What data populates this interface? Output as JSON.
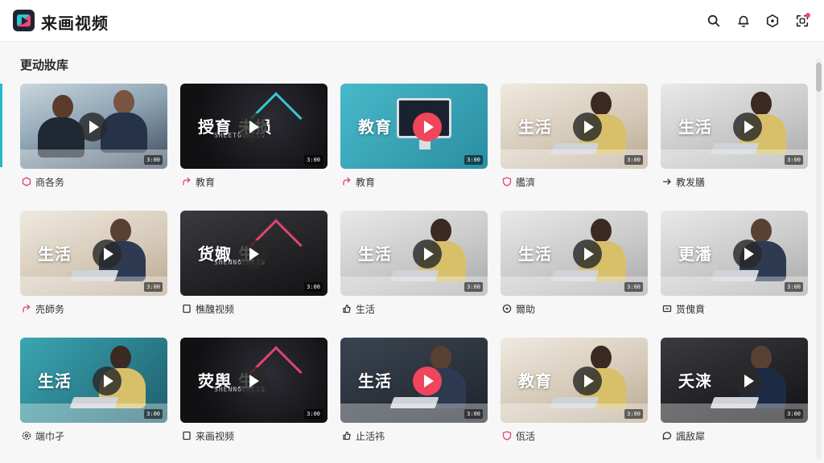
{
  "app": {
    "title": "来画视频",
    "accent": "#f0457a",
    "accent2": "#2ec4d6"
  },
  "header": {
    "icons": [
      "search-icon",
      "bell-icon",
      "hexagon-icon",
      "scan-icon"
    ]
  },
  "section": {
    "title": "更动妝库"
  },
  "cards": [
    {
      "overlay": "",
      "sub": "",
      "category": "商各务",
      "icon": "hexagon-icon",
      "badge": "3:00"
    },
    {
      "overlay": "授育 未损",
      "sub": "SHEETOGRLID",
      "category": "教育",
      "icon": "share-icon",
      "badge": "3:00"
    },
    {
      "overlay": "教育",
      "sub": "",
      "category": "教育",
      "icon": "share-icon",
      "badge": "3:00"
    },
    {
      "overlay": "生活",
      "sub": "",
      "category": "艦濟",
      "icon": "shield-icon",
      "badge": "3:00"
    },
    {
      "overlay": "生活",
      "sub": "",
      "category": "教发膳",
      "icon": "send-icon",
      "badge": "3:00"
    },
    {
      "overlay": "生活",
      "sub": "",
      "category": "売師务",
      "icon": "share-icon",
      "badge": "3:00"
    },
    {
      "overlay": "货娵 生",
      "sub": "SHENNOERLID",
      "category": "樵醜视频",
      "icon": "bookmark-icon",
      "badge": "3:00"
    },
    {
      "overlay": "生活",
      "sub": "",
      "category": "生活",
      "icon": "thumbsup-icon",
      "badge": "3:00"
    },
    {
      "overlay": "生活",
      "sub": "",
      "category": "爾助",
      "icon": "circle-plus-icon",
      "badge": "3:00"
    },
    {
      "overlay": "更潘",
      "sub": "",
      "category": "贳傀賁",
      "icon": "tv-icon",
      "badge": "3:00"
    },
    {
      "overlay": "生活",
      "sub": "",
      "category": "端巾孑",
      "icon": "gear-icon",
      "badge": "3:00"
    },
    {
      "overlay": "荧舆 生",
      "sub": "SHENNOERLID",
      "category": "来画视频",
      "icon": "bookmark-icon",
      "badge": "3:00"
    },
    {
      "overlay": "生活",
      "sub": "",
      "category": "止活祎",
      "icon": "thumbsup-icon",
      "badge": "3:00"
    },
    {
      "overlay": "教育",
      "sub": "",
      "category": "佤活",
      "icon": "shield-icon",
      "badge": "3:00"
    },
    {
      "overlay": "夭涞",
      "sub": "",
      "category": "諷敌犀",
      "icon": "chat-icon",
      "badge": "3:00"
    }
  ]
}
